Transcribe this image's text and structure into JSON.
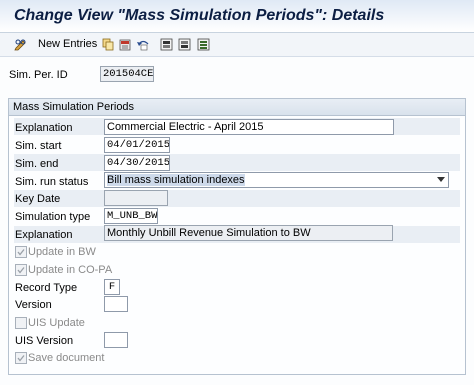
{
  "window": {
    "title": "Change View \"Mass Simulation Periods\": Details"
  },
  "toolbar": {
    "new_entries": "New Entries",
    "icons": [
      "pencil-glasses-icon",
      "copy-icon",
      "delete-icon",
      "undo-icon",
      "previous-entry-icon",
      "next-entry-icon",
      "select-all-icon"
    ]
  },
  "header": {
    "sim_per_id_label": "Sim. Per. ID",
    "sim_per_id_value": "201504CE"
  },
  "group": {
    "title": "Mass Simulation Periods",
    "explanation_label": "Explanation",
    "explanation_value": "Commercial Electric - April 2015",
    "sim_start_label": "Sim. start",
    "sim_start_value": "04/01/2015",
    "sim_end_label": "Sim. end",
    "sim_end_value": "04/30/2015",
    "sim_run_status_label": "Sim. run status",
    "sim_run_status_value": "Bill mass simulation indexes",
    "key_date_label": "Key Date",
    "key_date_value": "",
    "simulation_type_label": "Simulation type",
    "simulation_type_value": "M_UNB_BW",
    "explanation2_label": "Explanation",
    "explanation2_value": "Monthly Unbill Revenue Simulation to BW",
    "update_in_bw_label": "Update in BW",
    "update_in_copa_label": "Update in CO-PA",
    "record_type_label": "Record Type",
    "record_type_value": "F",
    "version_label": "Version",
    "version_value": "",
    "uis_update_label": "UIS Update",
    "uis_version_label": "UIS Version",
    "uis_version_value": "",
    "save_document_label": "Save document"
  }
}
